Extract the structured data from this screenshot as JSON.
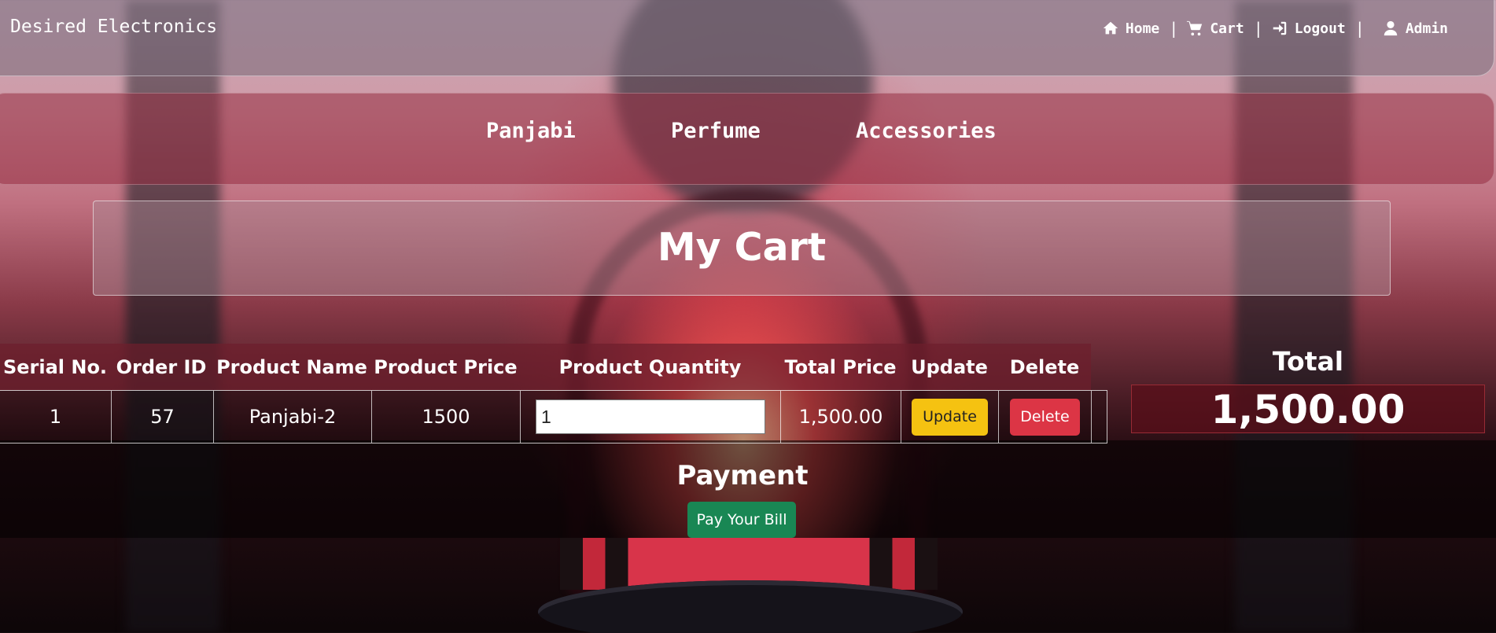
{
  "brand": "Desired Electronics",
  "top_nav": {
    "home": "Home",
    "cart": "Cart",
    "logout": "Logout",
    "admin": "Admin",
    "separator": "|"
  },
  "categories": [
    "Panjabi",
    "Perfume",
    "Accessories"
  ],
  "page_title": "My Cart",
  "table": {
    "headers": [
      "Serial No.",
      "Order ID",
      "Product Name",
      "Product Price",
      "Product Quantity",
      "Total Price",
      "Update",
      "Delete"
    ],
    "rows": [
      {
        "serial": "1",
        "order_id": "57",
        "product_name": "Panjabi-2",
        "product_price": "1500",
        "quantity": "1",
        "total_price": "1,500.00",
        "update_label": "Update",
        "delete_label": "Delete"
      }
    ]
  },
  "summary": {
    "total_label": "Total",
    "total_value": "1,500.00"
  },
  "payment": {
    "heading": "Payment",
    "button_label": "Pay Your Bill"
  },
  "colors": {
    "update_button": "#f5c211",
    "delete_button": "#dc3545",
    "pay_button": "#198754"
  }
}
